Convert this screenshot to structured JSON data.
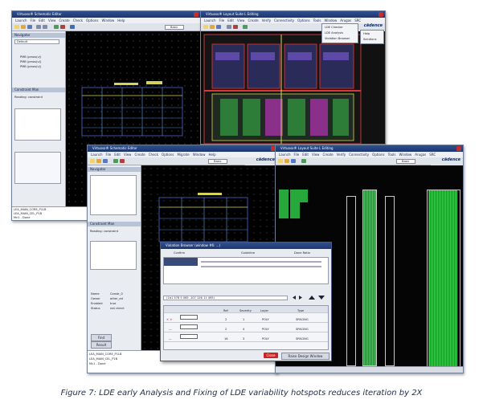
{
  "caption": "Figure 7: LDE early Analysis and Fixing of LDE variability hotspots reduces iteration by 2X",
  "brand": "cādence",
  "colors": {
    "title_bar": "#2f4f8f",
    "canvas": "#000000",
    "layout_green": "#27a83a",
    "close_red": "#cc2222"
  },
  "win_schematic_top": {
    "menu": [
      "Launch",
      "File",
      "Edit",
      "View",
      "Create",
      "Check",
      "Options",
      "Window",
      "Help"
    ],
    "workspace": "Basic",
    "navigator_title": "Navigator",
    "navigator_filter": "Default",
    "nav_items": [
      "PMB (pmos(v))",
      "PMB (pmos(v))",
      "PMB (pmos(v))"
    ],
    "constraint_title": "Constraint Man",
    "reading": "Reading: constraint",
    "status_text": [
      "LEA_MAIN_CORE_P1LB",
      "LEA_MAIN_CEL_P1B",
      "Mc1 - Done"
    ]
  },
  "win_layout_top": {
    "menu": [
      "Launch",
      "File",
      "Edit",
      "View",
      "Create",
      "Verify",
      "Connectivity",
      "Options",
      "Tools",
      "Window",
      "Arugas",
      "SRC"
    ],
    "popup_menu": [
      "LDE Checker",
      "LDE Analysis",
      "Violation Browser"
    ],
    "popup_side": [
      "Help",
      "Solutions"
    ]
  },
  "win_schematic_bottom": {
    "menu": [
      "Launch",
      "File",
      "Edit",
      "View",
      "Create",
      "Check",
      "Options",
      "Migrate",
      "Window",
      "Help"
    ],
    "workspace": "Basic",
    "navigator_title": "Navigator",
    "constraint_title": "Constraint Man",
    "reading": "Reading: constraint",
    "props": [
      [
        "Name",
        "Constr_0"
      ],
      [
        "Owner",
        "other_ed"
      ],
      [
        "Enabled",
        "true"
      ],
      [
        "Status",
        "not check"
      ]
    ],
    "log_lines": [
      "LEA_MAIN_CORE_P1LB",
      "LEA_MAIN_CEL_P1B",
      "Mc1 - Done"
    ],
    "find_label": "Find",
    "tabs": [
      "Find",
      "Result"
    ]
  },
  "win_layout_bottom": {
    "menu": [
      "Launch",
      "File",
      "Edit",
      "View",
      "Create",
      "Verify",
      "Connectivity",
      "Options",
      "Tools",
      "Window",
      "Arugas",
      "SRC"
    ],
    "workspace": "Basic"
  },
  "violation_dialog": {
    "title": "Violation Browser (window #6: ...)",
    "columns": [
      "Confirm",
      "Guideline",
      "Done Ratio"
    ],
    "location": "(1b1 578 5 065 .107 126 11 495)",
    "table_headers": [
      "",
      "Ref",
      "Severity",
      "Layer",
      "Type"
    ],
    "rows": [
      {
        "ref": "2",
        "severity": "1",
        "layer": "POLY",
        "type": "SPACING"
      },
      {
        "ref": "2",
        "severity": "4",
        "layer": "POLY",
        "type": "SPACING"
      },
      {
        "ref": "16",
        "severity": "3",
        "layer": "POLY",
        "type": "SPACING"
      }
    ],
    "close_label": "Close",
    "help_label": "Raise Design Window"
  }
}
